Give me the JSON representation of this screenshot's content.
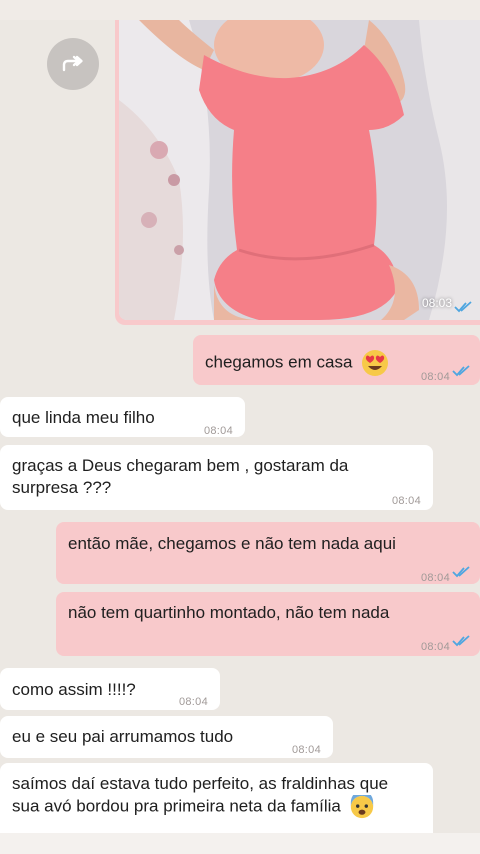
{
  "image_message": {
    "time": "08:03"
  },
  "messages": [
    {
      "side": "out",
      "text": "chegamos em casa",
      "time": "08:04",
      "emoji": "heart-eyes"
    },
    {
      "side": "in",
      "text": "que linda meu filho",
      "time": "08:04"
    },
    {
      "side": "in",
      "text": "graças a Deus chegaram bem , gostaram da surpresa ???",
      "time": "08:04"
    },
    {
      "side": "out",
      "text": "então mãe, chegamos e não tem nada aqui",
      "time": "08:04"
    },
    {
      "side": "out",
      "text": "não tem quartinho montado, não tem nada",
      "time": "08:04"
    },
    {
      "side": "in",
      "text": "como assim !!!!?",
      "time": "08:04"
    },
    {
      "side": "in",
      "text": "eu e seu pai arrumamos tudo",
      "time": "08:04"
    },
    {
      "side": "in",
      "text": "saímos daí estava tudo perfeito, as fraldinhas que sua avó bordou pra primeira neta da família",
      "time": "",
      "emoji": "fearful-face"
    }
  ],
  "colors": {
    "outgoing": "#f8c9cb",
    "incoming": "#ffffff",
    "background": "#ece8e3",
    "read_ticks": "#4fa6e0"
  }
}
